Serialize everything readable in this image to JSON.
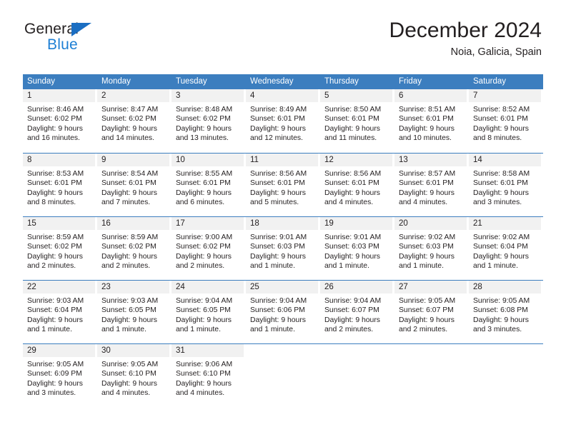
{
  "brand": {
    "name_part1": "General",
    "name_part2": "Blue",
    "accent_color": "#1d7fd4",
    "triangle_color": "#1b6ec2"
  },
  "header": {
    "title": "December 2024",
    "location": "Noia, Galicia, Spain"
  },
  "calendar": {
    "header_bg": "#3c7ebf",
    "header_text_color": "#ffffff",
    "day_band_bg": "#f1f1f1",
    "weekdays": [
      "Sunday",
      "Monday",
      "Tuesday",
      "Wednesday",
      "Thursday",
      "Friday",
      "Saturday"
    ],
    "weeks": [
      [
        {
          "day": "1",
          "sunrise": "Sunrise: 8:46 AM",
          "sunset": "Sunset: 6:02 PM",
          "daylight1": "Daylight: 9 hours",
          "daylight2": "and 16 minutes."
        },
        {
          "day": "2",
          "sunrise": "Sunrise: 8:47 AM",
          "sunset": "Sunset: 6:02 PM",
          "daylight1": "Daylight: 9 hours",
          "daylight2": "and 14 minutes."
        },
        {
          "day": "3",
          "sunrise": "Sunrise: 8:48 AM",
          "sunset": "Sunset: 6:02 PM",
          "daylight1": "Daylight: 9 hours",
          "daylight2": "and 13 minutes."
        },
        {
          "day": "4",
          "sunrise": "Sunrise: 8:49 AM",
          "sunset": "Sunset: 6:01 PM",
          "daylight1": "Daylight: 9 hours",
          "daylight2": "and 12 minutes."
        },
        {
          "day": "5",
          "sunrise": "Sunrise: 8:50 AM",
          "sunset": "Sunset: 6:01 PM",
          "daylight1": "Daylight: 9 hours",
          "daylight2": "and 11 minutes."
        },
        {
          "day": "6",
          "sunrise": "Sunrise: 8:51 AM",
          "sunset": "Sunset: 6:01 PM",
          "daylight1": "Daylight: 9 hours",
          "daylight2": "and 10 minutes."
        },
        {
          "day": "7",
          "sunrise": "Sunrise: 8:52 AM",
          "sunset": "Sunset: 6:01 PM",
          "daylight1": "Daylight: 9 hours",
          "daylight2": "and 8 minutes."
        }
      ],
      [
        {
          "day": "8",
          "sunrise": "Sunrise: 8:53 AM",
          "sunset": "Sunset: 6:01 PM",
          "daylight1": "Daylight: 9 hours",
          "daylight2": "and 8 minutes."
        },
        {
          "day": "9",
          "sunrise": "Sunrise: 8:54 AM",
          "sunset": "Sunset: 6:01 PM",
          "daylight1": "Daylight: 9 hours",
          "daylight2": "and 7 minutes."
        },
        {
          "day": "10",
          "sunrise": "Sunrise: 8:55 AM",
          "sunset": "Sunset: 6:01 PM",
          "daylight1": "Daylight: 9 hours",
          "daylight2": "and 6 minutes."
        },
        {
          "day": "11",
          "sunrise": "Sunrise: 8:56 AM",
          "sunset": "Sunset: 6:01 PM",
          "daylight1": "Daylight: 9 hours",
          "daylight2": "and 5 minutes."
        },
        {
          "day": "12",
          "sunrise": "Sunrise: 8:56 AM",
          "sunset": "Sunset: 6:01 PM",
          "daylight1": "Daylight: 9 hours",
          "daylight2": "and 4 minutes."
        },
        {
          "day": "13",
          "sunrise": "Sunrise: 8:57 AM",
          "sunset": "Sunset: 6:01 PM",
          "daylight1": "Daylight: 9 hours",
          "daylight2": "and 4 minutes."
        },
        {
          "day": "14",
          "sunrise": "Sunrise: 8:58 AM",
          "sunset": "Sunset: 6:01 PM",
          "daylight1": "Daylight: 9 hours",
          "daylight2": "and 3 minutes."
        }
      ],
      [
        {
          "day": "15",
          "sunrise": "Sunrise: 8:59 AM",
          "sunset": "Sunset: 6:02 PM",
          "daylight1": "Daylight: 9 hours",
          "daylight2": "and 2 minutes."
        },
        {
          "day": "16",
          "sunrise": "Sunrise: 8:59 AM",
          "sunset": "Sunset: 6:02 PM",
          "daylight1": "Daylight: 9 hours",
          "daylight2": "and 2 minutes."
        },
        {
          "day": "17",
          "sunrise": "Sunrise: 9:00 AM",
          "sunset": "Sunset: 6:02 PM",
          "daylight1": "Daylight: 9 hours",
          "daylight2": "and 2 minutes."
        },
        {
          "day": "18",
          "sunrise": "Sunrise: 9:01 AM",
          "sunset": "Sunset: 6:03 PM",
          "daylight1": "Daylight: 9 hours",
          "daylight2": "and 1 minute."
        },
        {
          "day": "19",
          "sunrise": "Sunrise: 9:01 AM",
          "sunset": "Sunset: 6:03 PM",
          "daylight1": "Daylight: 9 hours",
          "daylight2": "and 1 minute."
        },
        {
          "day": "20",
          "sunrise": "Sunrise: 9:02 AM",
          "sunset": "Sunset: 6:03 PM",
          "daylight1": "Daylight: 9 hours",
          "daylight2": "and 1 minute."
        },
        {
          "day": "21",
          "sunrise": "Sunrise: 9:02 AM",
          "sunset": "Sunset: 6:04 PM",
          "daylight1": "Daylight: 9 hours",
          "daylight2": "and 1 minute."
        }
      ],
      [
        {
          "day": "22",
          "sunrise": "Sunrise: 9:03 AM",
          "sunset": "Sunset: 6:04 PM",
          "daylight1": "Daylight: 9 hours",
          "daylight2": "and 1 minute."
        },
        {
          "day": "23",
          "sunrise": "Sunrise: 9:03 AM",
          "sunset": "Sunset: 6:05 PM",
          "daylight1": "Daylight: 9 hours",
          "daylight2": "and 1 minute."
        },
        {
          "day": "24",
          "sunrise": "Sunrise: 9:04 AM",
          "sunset": "Sunset: 6:05 PM",
          "daylight1": "Daylight: 9 hours",
          "daylight2": "and 1 minute."
        },
        {
          "day": "25",
          "sunrise": "Sunrise: 9:04 AM",
          "sunset": "Sunset: 6:06 PM",
          "daylight1": "Daylight: 9 hours",
          "daylight2": "and 1 minute."
        },
        {
          "day": "26",
          "sunrise": "Sunrise: 9:04 AM",
          "sunset": "Sunset: 6:07 PM",
          "daylight1": "Daylight: 9 hours",
          "daylight2": "and 2 minutes."
        },
        {
          "day": "27",
          "sunrise": "Sunrise: 9:05 AM",
          "sunset": "Sunset: 6:07 PM",
          "daylight1": "Daylight: 9 hours",
          "daylight2": "and 2 minutes."
        },
        {
          "day": "28",
          "sunrise": "Sunrise: 9:05 AM",
          "sunset": "Sunset: 6:08 PM",
          "daylight1": "Daylight: 9 hours",
          "daylight2": "and 3 minutes."
        }
      ],
      [
        {
          "day": "29",
          "sunrise": "Sunrise: 9:05 AM",
          "sunset": "Sunset: 6:09 PM",
          "daylight1": "Daylight: 9 hours",
          "daylight2": "and 3 minutes."
        },
        {
          "day": "30",
          "sunrise": "Sunrise: 9:05 AM",
          "sunset": "Sunset: 6:10 PM",
          "daylight1": "Daylight: 9 hours",
          "daylight2": "and 4 minutes."
        },
        {
          "day": "31",
          "sunrise": "Sunrise: 9:06 AM",
          "sunset": "Sunset: 6:10 PM",
          "daylight1": "Daylight: 9 hours",
          "daylight2": "and 4 minutes."
        },
        {
          "day": "",
          "sunrise": "",
          "sunset": "",
          "daylight1": "",
          "daylight2": ""
        },
        {
          "day": "",
          "sunrise": "",
          "sunset": "",
          "daylight1": "",
          "daylight2": ""
        },
        {
          "day": "",
          "sunrise": "",
          "sunset": "",
          "daylight1": "",
          "daylight2": ""
        },
        {
          "day": "",
          "sunrise": "",
          "sunset": "",
          "daylight1": "",
          "daylight2": ""
        }
      ]
    ]
  }
}
